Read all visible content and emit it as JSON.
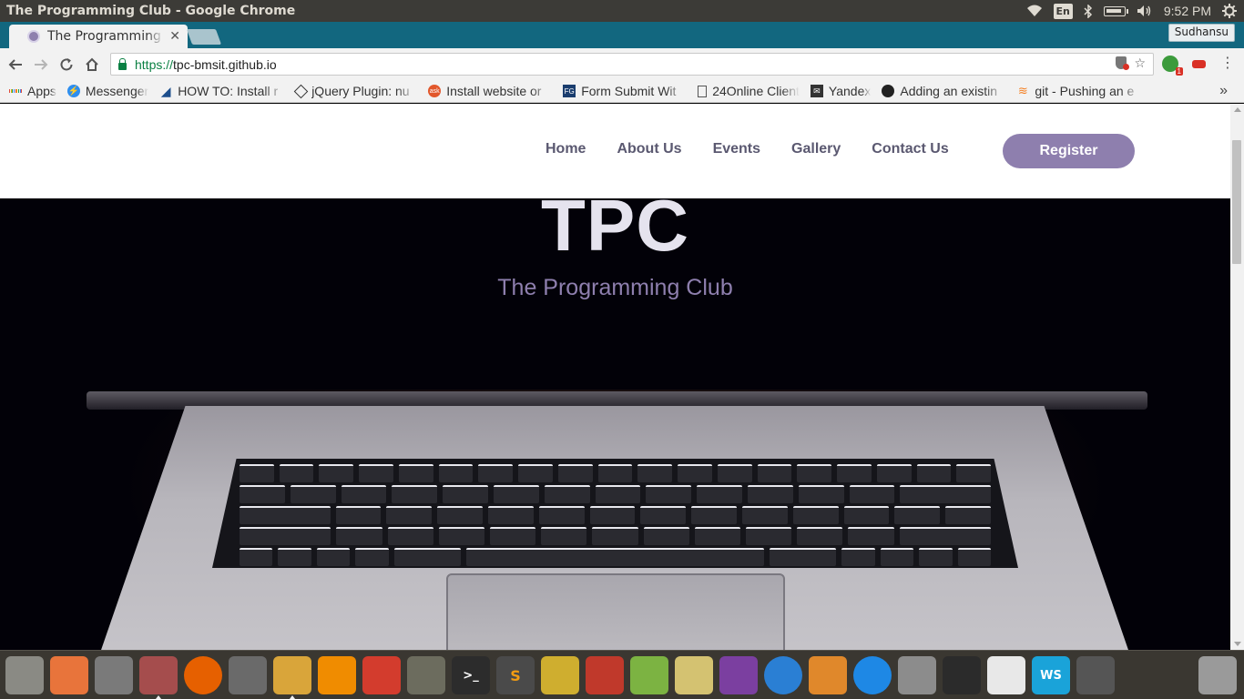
{
  "window": {
    "title": "The Programming Club - Google Chrome"
  },
  "panel": {
    "language": "En",
    "time": "9:52 PM"
  },
  "browser": {
    "tab_title": "The Programming Club - TPC",
    "profile": "Sudhansu",
    "url_scheme": "https://",
    "url_host": "tpc-bmsit.github.io",
    "extension_badge": "1",
    "bookmarks": [
      {
        "label": "Apps",
        "icon": "apps-grid-icon"
      },
      {
        "label": "Messenger",
        "icon": "messenger-icon"
      },
      {
        "label": "HOW TO: Install r",
        "icon": "bookmark-site-icon"
      },
      {
        "label": "jQuery Plugin: nu",
        "icon": "codepen-icon"
      },
      {
        "label": "Install website or",
        "icon": "ask-icon"
      },
      {
        "label": "Form Submit Wit",
        "icon": "fg-icon"
      },
      {
        "label": "24Online Client",
        "icon": "page-icon"
      },
      {
        "label": "Yandex",
        "icon": "mail-icon"
      },
      {
        "label": "Adding an existin",
        "icon": "github-icon"
      },
      {
        "label": "git - Pushing an e",
        "icon": "stackoverflow-icon"
      }
    ],
    "more_bookmarks": "»"
  },
  "site": {
    "nav": [
      "Home",
      "About Us",
      "Events",
      "Gallery",
      "Contact Us"
    ],
    "register": "Register",
    "hero_title": "TPC",
    "hero_subtitle": "The Programming Club"
  },
  "dock": [
    {
      "name": "ubuntu-dash-icon",
      "color": "#8a8a84",
      "active": false
    },
    {
      "name": "software-center-icon",
      "color": "#e8743b",
      "active": false
    },
    {
      "name": "system-settings-icon",
      "color": "#7a7a7a",
      "active": false
    },
    {
      "name": "files-icon",
      "color": "#a54d4d",
      "active": true
    },
    {
      "name": "firefox-icon",
      "color": "#e66000",
      "active": false
    },
    {
      "name": "calculator-icon",
      "color": "#6a6a6a",
      "active": false
    },
    {
      "name": "chrome-icon",
      "color": "#d9a53a",
      "active": true
    },
    {
      "name": "vlc-icon",
      "color": "#f08c00",
      "active": false
    },
    {
      "name": "git-icon",
      "color": "#d33c2d",
      "active": false
    },
    {
      "name": "gimp-icon",
      "color": "#6c6c5e",
      "active": false
    },
    {
      "name": "terminal-icon",
      "color": "#2c2c2c",
      "active": false
    },
    {
      "name": "sublime-text-icon",
      "color": "#4a4a4a",
      "active": false
    },
    {
      "name": "teapot-icon",
      "color": "#cfae2f",
      "active": false
    },
    {
      "name": "maps-icon",
      "color": "#c0392b",
      "active": false
    },
    {
      "name": "android-studio-icon",
      "color": "#7cb342",
      "active": false
    },
    {
      "name": "rhythmbox-icon",
      "color": "#d4c271",
      "active": false
    },
    {
      "name": "video-editor-icon",
      "color": "#7b3fa0",
      "active": false
    },
    {
      "name": "media-player-icon",
      "color": "#2a7fd4",
      "active": false
    },
    {
      "name": "scratch-cat-icon",
      "color": "#e0882b",
      "active": false
    },
    {
      "name": "teamviewer-icon",
      "color": "#1e88e5",
      "active": false
    },
    {
      "name": "text-editor-icon",
      "color": "#8c8c8c",
      "active": false
    },
    {
      "name": "inkscape-icon",
      "color": "#2b2b2b",
      "active": false
    },
    {
      "name": "pdf-viewer-icon",
      "color": "#e8e8e8",
      "active": false
    },
    {
      "name": "webstorm-icon",
      "color": "#1aa3d9",
      "active": false
    },
    {
      "name": "workspace-switcher-icon",
      "color": "#555",
      "active": false
    },
    {
      "name": "trash-icon",
      "color": "#9a9a9a",
      "active": false
    }
  ]
}
